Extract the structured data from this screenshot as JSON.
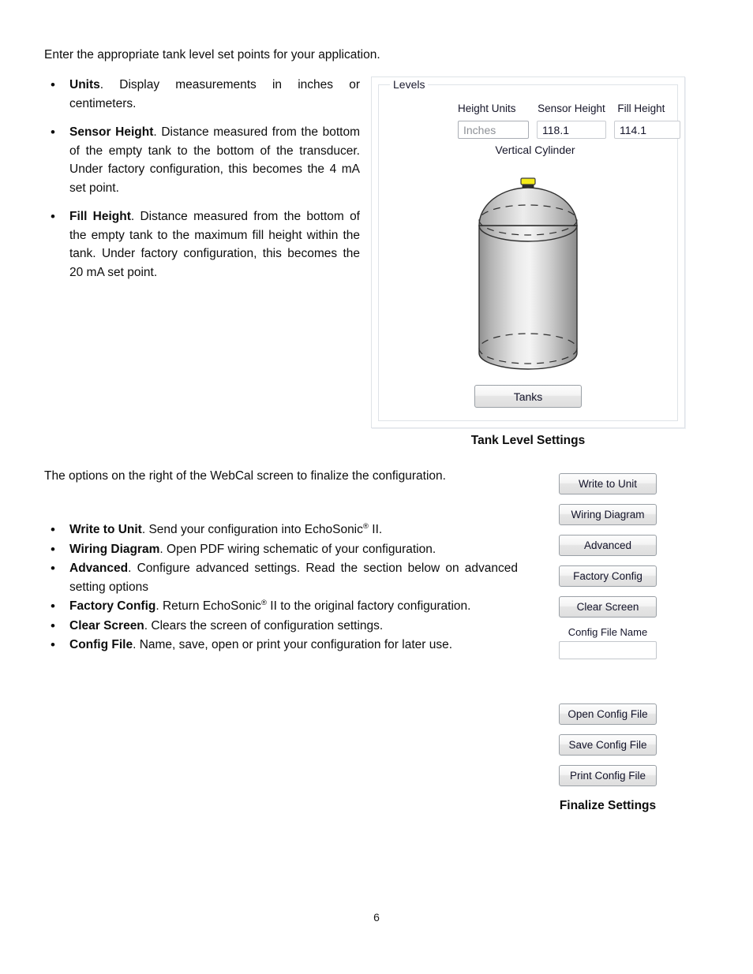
{
  "document": {
    "intro": "Enter the appropriate tank level set points for your application.",
    "upper_bullets": [
      {
        "term": "Units",
        "text": ". Display measurements in inches or centimeters."
      },
      {
        "term": "Sensor Height",
        "text": ". Distance measured from the bottom of the empty tank to the bottom of the transducer. Under factory configuration, this becomes the 4 mA set point."
      },
      {
        "term": "Fill Height",
        "text": ". Distance measured from the bottom of the empty tank to the maximum fill height within the tank. Under factory configuration, this becomes the 20 mA set point."
      }
    ],
    "lower_paragraph": "The options on the right of the WebCal screen to finalize the configuration.",
    "lower_bullets": [
      {
        "term": "Write to Unit",
        "text": ". Send your configuration into EchoSonic",
        "sup": "®",
        "tail": " II."
      },
      {
        "term": "Wiring Diagram",
        "text": ". Open PDF wiring schematic of your configuration.",
        "sup": "",
        "tail": ""
      },
      {
        "term": "Advanced",
        "text": ". Configure advanced settings. Read the section below on advanced setting options",
        "sup": "",
        "tail": ""
      },
      {
        "term": "Factory Config",
        "text": ". Return EchoSonic",
        "sup": "®",
        "tail": " II to the original factory configuration."
      },
      {
        "term": "Clear Screen",
        "text": ". Clears the screen of configuration settings.",
        "sup": "",
        "tail": ""
      },
      {
        "term": "Config File",
        "text": ". Name, save, open or print your configuration for later use.",
        "sup": "",
        "tail": ""
      }
    ],
    "page_number": "6"
  },
  "captions": {
    "tank": "Tank Level Settings",
    "finalize": "Finalize Settings"
  },
  "tank_panel": {
    "legend": "Levels",
    "labels": {
      "height_units": "Height Units",
      "sensor_height": "Sensor Height",
      "fill_height": "Fill Height"
    },
    "values": {
      "height_units": "Inches",
      "sensor_height": "118.1",
      "fill_height": "114.1"
    },
    "tank_type": "Vertical Cylinder",
    "tanks_button": "Tanks",
    "colors": {
      "sensor_cap": "#f5ec1a",
      "tank_body_light": "#f2f2f2",
      "tank_body_dark": "#9a9a9a",
      "panel_border": "#dfe3e8"
    }
  },
  "finalize_panel": {
    "buttons": [
      "Write to Unit",
      "Wiring Diagram",
      "Advanced",
      "Factory Config",
      "Clear Screen"
    ],
    "config_file_name_label": "Config File Name",
    "config_file_name_value": "",
    "file_buttons": [
      "Open Config File",
      "Save Config File",
      "Print Config File"
    ]
  }
}
